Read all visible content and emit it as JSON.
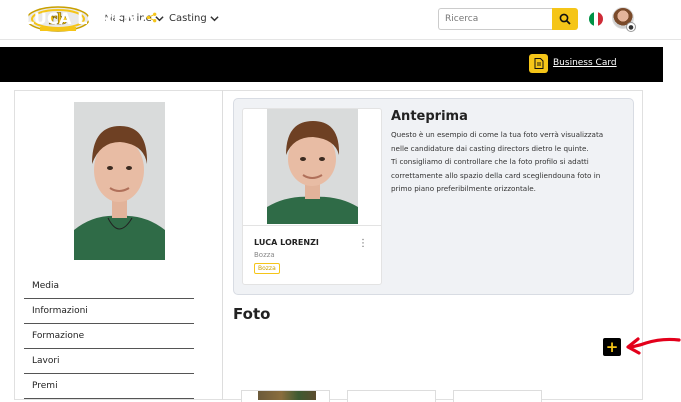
{
  "header": {
    "logo_text": "rb",
    "nav": [
      {
        "label": "Magazine"
      },
      {
        "label": "Casting"
      }
    ],
    "search": {
      "placeholder": "Ricerca"
    },
    "language": "it"
  },
  "profile": {
    "name": "LUCA LORENZI",
    "business_card_label": "Business Card"
  },
  "sidebar": {
    "items": [
      {
        "label": "Media"
      },
      {
        "label": "Informazioni"
      },
      {
        "label": "Formazione"
      },
      {
        "label": "Lavori"
      },
      {
        "label": "Premi"
      }
    ]
  },
  "preview": {
    "title": "Anteprima",
    "text_lines": [
      "Questo è un esempio di come la tua foto verrà visualizzata",
      "nelle candidature dai casting directors dietro le quinte.",
      "Ti consigliamo di controllare che la foto profilo si adatti",
      "correttamente allo spazio della card scegliendouna foto in",
      "primo piano preferibilmente orizzontale."
    ],
    "card": {
      "name": "LUCA LORENZI",
      "status": "Bozza",
      "badge": "Bozza"
    }
  },
  "photos": {
    "title": "Foto",
    "add_symbol": "+"
  },
  "colors": {
    "accent": "#f5c518",
    "hero_bg": "#000000",
    "annotation_arrow": "#e3001b"
  }
}
